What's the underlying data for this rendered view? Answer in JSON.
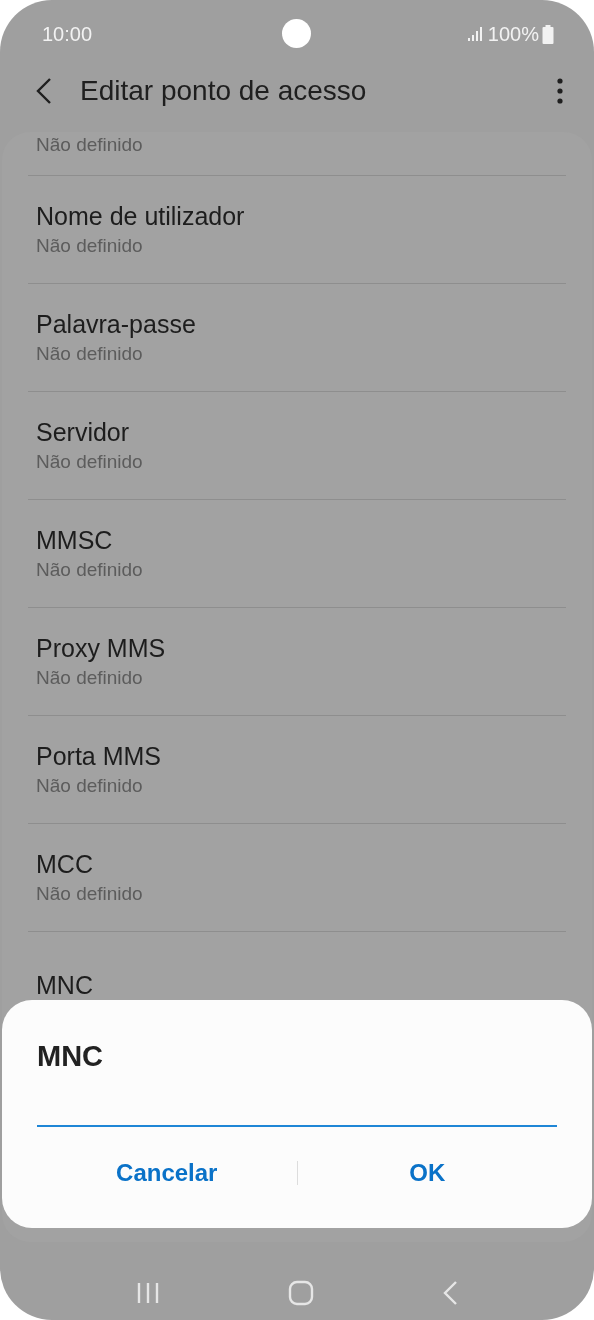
{
  "status_bar": {
    "time": "10:00",
    "battery": "100%"
  },
  "app_bar": {
    "title": "Editar ponto de acesso"
  },
  "list": {
    "top_cut_value": "Não definido",
    "items": [
      {
        "title": "Nome de utilizador",
        "value": "Não definido"
      },
      {
        "title": "Palavra-passe",
        "value": "Não definido"
      },
      {
        "title": "Servidor",
        "value": "Não definido"
      },
      {
        "title": "MMSC",
        "value": "Não definido"
      },
      {
        "title": "Proxy MMS",
        "value": "Não definido"
      },
      {
        "title": "Porta MMS",
        "value": "Não definido"
      },
      {
        "title": "MCC",
        "value": "Não definido"
      },
      {
        "title": "MNC"
      }
    ]
  },
  "dialog": {
    "title": "MNC",
    "buttons": [
      "Cancelar",
      "OK"
    ]
  }
}
